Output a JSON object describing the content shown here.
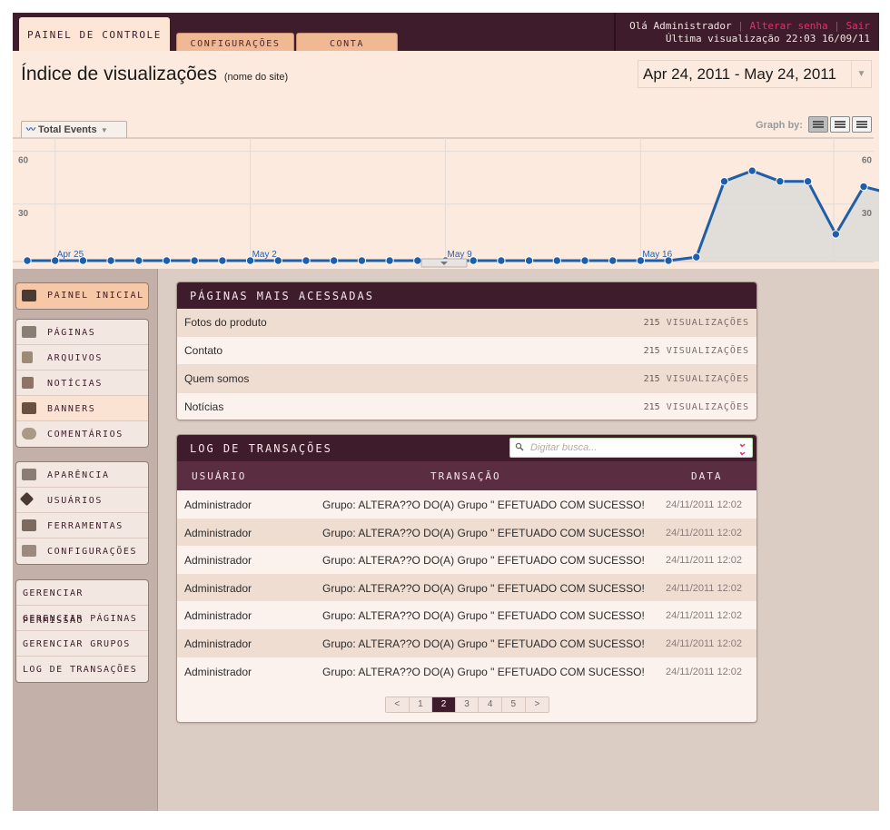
{
  "topbar": {
    "tabs": [
      {
        "label": "Painel de Controle",
        "active": true
      },
      {
        "label": "Configurações",
        "active": false
      },
      {
        "label": "Conta",
        "active": false
      }
    ],
    "greeting": "Olá Administrador",
    "sep": "|",
    "change_password": "Alterar senha",
    "logout": "Sair",
    "last_visit": "Última visualização 22:03 16/09/11"
  },
  "header": {
    "title": "Índice de visualizações",
    "subtitle": "(nome do site)",
    "date_range": "Apr 24, 2011 - May 24, 2011",
    "metric_button": "Total Events",
    "graph_by_label": "Graph by:"
  },
  "chart_data": {
    "type": "area",
    "series": [
      {
        "name": "Total Events",
        "values": [
          0,
          0,
          0,
          0,
          0,
          0,
          0,
          0,
          0,
          0,
          0,
          0,
          0,
          0,
          0,
          0,
          0,
          0,
          0,
          0,
          0,
          0,
          0,
          0,
          2,
          45,
          51,
          45,
          45,
          15,
          42,
          38
        ]
      }
    ],
    "x_labels": [
      "Apr 25",
      "May 2",
      "May 9",
      "May 16"
    ],
    "x_label_indices": [
      1,
      8,
      15,
      22
    ],
    "y_ticks": [
      30,
      60
    ],
    "ylim": [
      0,
      60
    ],
    "colors": {
      "line": "#1f5ea8",
      "fill": "#dcdad8"
    }
  },
  "sidebar": {
    "groups": [
      {
        "items": [
          {
            "label": "Painel Inicial",
            "icon": "dashboard-icon",
            "highlight": true
          }
        ]
      },
      {
        "items": [
          {
            "label": "Páginas",
            "icon": "pages-icon"
          },
          {
            "label": "Arquivos",
            "icon": "files-icon"
          },
          {
            "label": "Notícias",
            "icon": "news-icon"
          },
          {
            "label": "Banners",
            "icon": "banners-icon",
            "highlight": true
          },
          {
            "label": "Comentários",
            "icon": "comments-icon"
          }
        ]
      },
      {
        "items": [
          {
            "label": "Aparência",
            "icon": "appearance-icon"
          },
          {
            "label": "Usuários",
            "icon": "users-icon"
          },
          {
            "label": "Ferramentas",
            "icon": "tools-icon"
          },
          {
            "label": "Configurações",
            "icon": "settings-icon"
          }
        ]
      },
      {
        "items": [
          {
            "label": "Gerenciar Permissão"
          },
          {
            "label": "Gerenciar Páginas"
          },
          {
            "label": "Gerenciar Grupos"
          },
          {
            "label": "Log de Transações"
          }
        ]
      }
    ]
  },
  "top_pages": {
    "title": "Páginas mais acessadas",
    "unit": "visualizações",
    "rows": [
      {
        "name": "Fotos do produto",
        "count": "215"
      },
      {
        "name": "Contato",
        "count": "215"
      },
      {
        "name": "Quem somos",
        "count": "215"
      },
      {
        "name": "Notícias",
        "count": "215"
      }
    ]
  },
  "log": {
    "title": "Log de Transações",
    "search_placeholder": "Digitar busca...",
    "columns": [
      "Usuário",
      "Transação",
      "Data"
    ],
    "rows": [
      {
        "user": "Administrador",
        "transaction": "Grupo: ALTERA??O DO(A) Grupo \" EFETUADO COM SUCESSO!",
        "date": "24/11/2011 12:02"
      },
      {
        "user": "Administrador",
        "transaction": "Grupo: ALTERA??O DO(A) Grupo \" EFETUADO COM SUCESSO!",
        "date": "24/11/2011 12:02"
      },
      {
        "user": "Administrador",
        "transaction": "Grupo: ALTERA??O DO(A) Grupo \" EFETUADO COM SUCESSO!",
        "date": "24/11/2011 12:02"
      },
      {
        "user": "Administrador",
        "transaction": "Grupo: ALTERA??O DO(A) Grupo \" EFETUADO COM SUCESSO!",
        "date": "24/11/2011 12:02"
      },
      {
        "user": "Administrador",
        "transaction": "Grupo: ALTERA??O DO(A) Grupo \" EFETUADO COM SUCESSO!",
        "date": "24/11/2011 12:02"
      },
      {
        "user": "Administrador",
        "transaction": "Grupo: ALTERA??O DO(A) Grupo \" EFETUADO COM SUCESSO!",
        "date": "24/11/2011 12:02"
      },
      {
        "user": "Administrador",
        "transaction": "Grupo: ALTERA??O DO(A) Grupo \" EFETUADO COM SUCESSO!",
        "date": "24/11/2011 12:02"
      }
    ],
    "pager": {
      "prev": "<",
      "next": ">",
      "pages": [
        "1",
        "2",
        "3",
        "4",
        "5"
      ],
      "current": "2"
    }
  },
  "colors": {
    "brand": "#3e1c2c",
    "accent": "#e0336a",
    "tab": "#f0b994",
    "header_bg": "#fdeade"
  }
}
